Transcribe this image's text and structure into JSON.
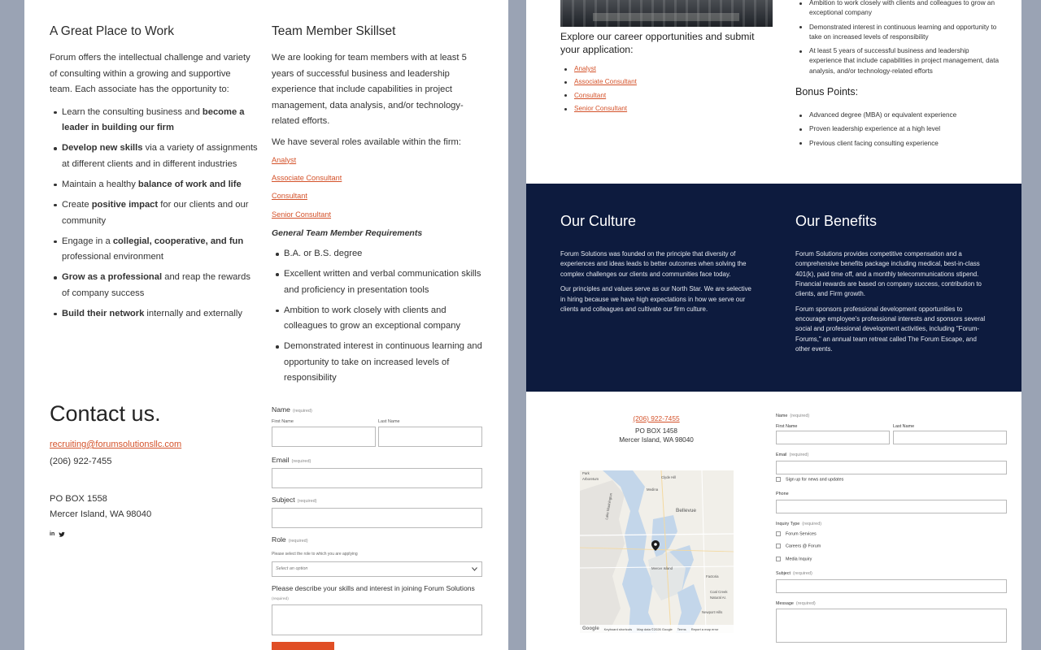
{
  "left": {
    "great_place": {
      "title": "A Great Place to Work",
      "intro": "Forum offers the intellectual challenge and variety of consulting within a growing and supportive team. Each associate has the opportunity to:",
      "bullets": [
        {
          "pre": "Learn the consulting business and ",
          "bold": "become a leader in building our firm",
          "post": ""
        },
        {
          "pre": "",
          "bold": "Develop new skills",
          "post": " via a variety of assignments at different clients and in different industries"
        },
        {
          "pre": "Maintain a healthy ",
          "bold": "balance of work and life",
          "post": ""
        },
        {
          "pre": "Create ",
          "bold": "positive impact",
          "post": " for our clients and our community"
        },
        {
          "pre": "Engage in a ",
          "bold": "collegial, cooperative, and fun",
          "post": " professional environment"
        },
        {
          "pre": "",
          "bold": "Grow as a professional",
          "post": " and reap the rewards of company success"
        },
        {
          "pre": "",
          "bold": "Build their network",
          "post": " internally and externally"
        }
      ]
    },
    "skillset": {
      "title": "Team Member Skillset",
      "p1": "We are looking for team members with at least 5 years of successful business and leadership experience that include capabilities in project management, data analysis, and/or technology-related efforts.",
      "p2": "We have several roles available within the firm:",
      "roles": [
        "Analyst",
        "Associate Consultant",
        "Consultant",
        "Senior Consultant"
      ],
      "req_title": "General Team Member Requirements",
      "requirements": [
        "B.A. or B.S. degree",
        "Excellent written and verbal communication skills and proficiency in presentation tools",
        "Ambition to work closely with clients and colleagues to grow an exceptional company",
        "Demonstrated interest in continuous learning and opportunity to take on increased levels of responsibility"
      ]
    },
    "contact": {
      "title": "Contact us.",
      "email": "recruiting@forumsolutionsllc.com",
      "phone": "(206) 922-7455",
      "address1": "PO BOX 1558",
      "address2": "Mercer Island, WA  98040",
      "social": [
        "linkedin-icon",
        "twitter-icon"
      ]
    },
    "form": {
      "name_label": "Name",
      "required": "(required)",
      "first_name": "First Name",
      "last_name": "Last Name",
      "email_label": "Email",
      "subject_label": "Subject",
      "role_label": "Role",
      "role_help": "Please select the role to which you are applying",
      "role_placeholder": "Select an option",
      "describe_label": "Please describe your skills and interest in joining Forum Solutions"
    }
  },
  "right": {
    "top_bullets": [
      "Ambition to work closely with clients and colleagues to grow an exceptional company",
      "Demonstrated interest in continuous learning and opportunity to take on increased levels of responsibility",
      "At least 5 years of successful business and leadership experience that include capabilities in project management, data analysis, and/or technology-related efforts"
    ],
    "explore": "Explore our career opportunities and submit your application:",
    "roles": [
      "Analyst",
      "Associate Consultant",
      "Consultant",
      "Senior Consultant"
    ],
    "bonus_title": "Bonus Points:",
    "bonus": [
      "Advanced degree (MBA) or equivalent experience",
      "Proven leadership experience at a high level",
      "Previous client facing consulting experience"
    ],
    "culture": {
      "title": "Our Culture",
      "p1": "Forum Solutions was founded on the principle that diversity of experiences and ideas leads to better outcomes when solving the complex challenges our clients and communities face today.",
      "p2": "Our principles and values serve as our North Star. We are selective in hiring because we have high expectations in how we serve our clients and colleagues and cultivate our firm culture."
    },
    "benefits": {
      "title": "Our Benefits",
      "p1": "Forum Solutions provides competitive compensation and a comprehensive benefits package including medical, best-in-class 401(k), paid time off, and a monthly telecommunications stipend. Financial rewards are based on company success, contribution to clients, and Firm growth.",
      "p2": "Forum sponsors professional development opportunities to encourage employee's professional interests and sponsors several social and professional development activities, including \"Forum-Forums,\" an annual team retreat called The Forum Escape, and other events."
    },
    "contact": {
      "phone": "(206) 922-7455",
      "address1": "PO BOX 1458",
      "address2": "Mercer Island, WA  98040"
    },
    "map": {
      "labels": [
        "Park",
        "Arboretum",
        "Clyde Hill",
        "Medina",
        "Bellevue",
        "Mercer Island",
        "Coal Creek",
        "Natural Ar.",
        "Newport Hills",
        "Factoria",
        "Lake Washington"
      ],
      "footer": [
        "Google",
        "Keyboard shortcuts",
        "Map data ©2026 Google",
        "Terms",
        "Report a map error"
      ]
    },
    "form": {
      "name_label": "Name",
      "required": "(required)",
      "first_name": "First Name",
      "last_name": "Last Name",
      "email_label": "Email",
      "signup": "Sign up for news and updates",
      "phone_label": "Phone",
      "inquiry_label": "Inquiry Type",
      "inquiry_options": [
        "Forum Services",
        "Careers @ Forum",
        "Media Inquiry"
      ],
      "subject_label": "Subject",
      "message_label": "Message"
    }
  }
}
